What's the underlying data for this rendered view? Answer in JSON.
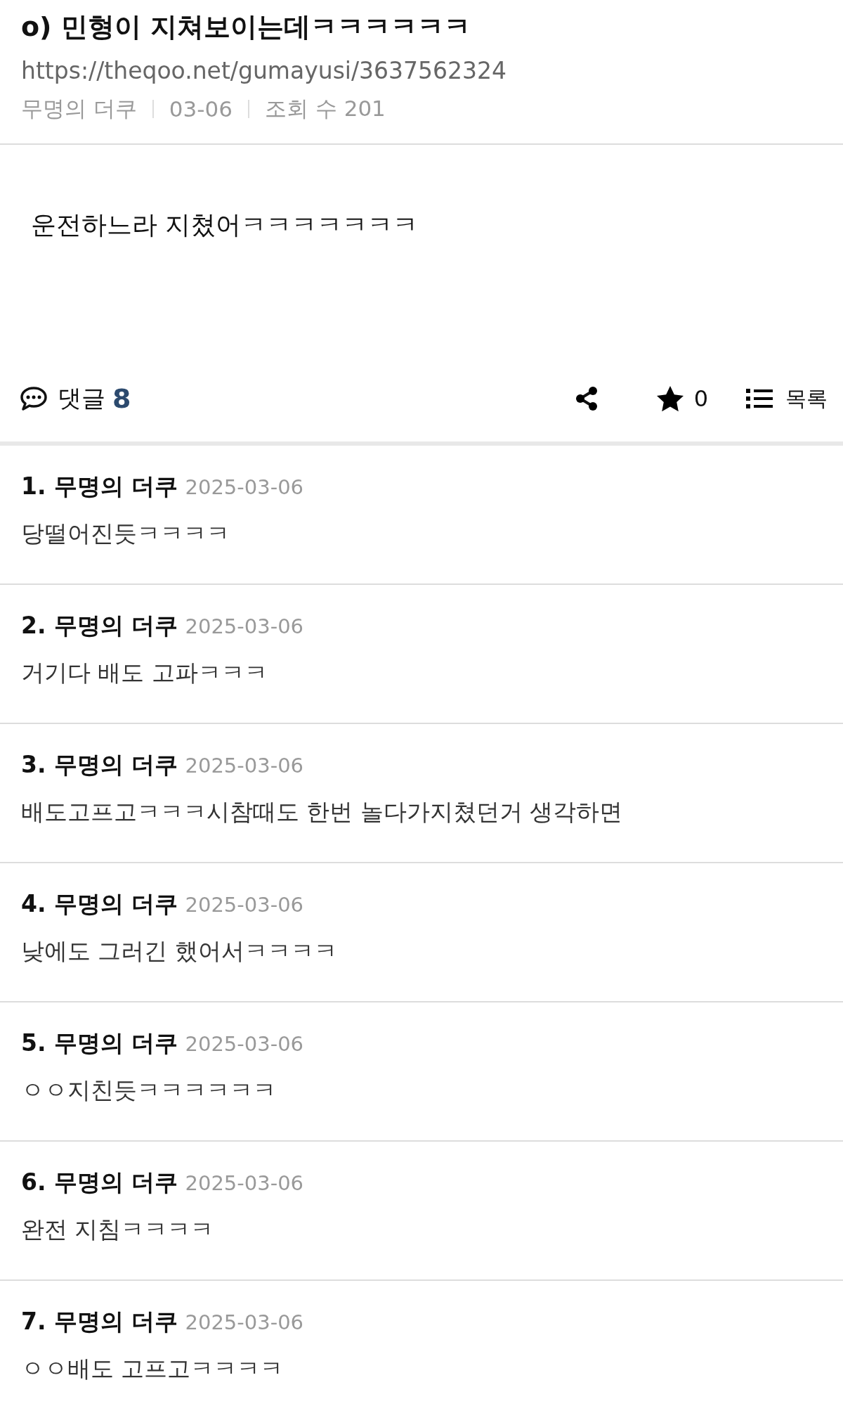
{
  "post": {
    "title": "o) 민형이 지쳐보이는데ㅋㅋㅋㅋㅋㅋ",
    "url": "https://theqoo.net/gumayusi/3637562324",
    "author": "무명의 더쿠",
    "date": "03-06",
    "views": "조회 수 201",
    "body": "운전하느라 지쳤어ㅋㅋㅋㅋㅋㅋㅋ"
  },
  "toolbar": {
    "comments_label": "댓글",
    "comments_count": "8",
    "stars": "0",
    "list_label": "목록"
  },
  "comments": [
    {
      "number": "1.",
      "author": "무명의 더쿠",
      "date": "2025-03-06",
      "text": "당떨어진듯ㅋㅋㅋㅋ"
    },
    {
      "number": "2.",
      "author": "무명의 더쿠",
      "date": "2025-03-06",
      "text": "거기다 배도 고파ㅋㅋㅋ"
    },
    {
      "number": "3.",
      "author": "무명의 더쿠",
      "date": "2025-03-06",
      "text": "배도고프고ㅋㅋㅋ시참때도 한번 놀다가지쳤던거 생각하면"
    },
    {
      "number": "4.",
      "author": "무명의 더쿠",
      "date": "2025-03-06",
      "text": "낮에도 그러긴 했어서ㅋㅋㅋㅋ"
    },
    {
      "number": "5.",
      "author": "무명의 더쿠",
      "date": "2025-03-06",
      "text": "ㅇㅇ지친듯ㅋㅋㅋㅋㅋㅋ"
    },
    {
      "number": "6.",
      "author": "무명의 더쿠",
      "date": "2025-03-06",
      "text": "완전 지침ㅋㅋㅋㅋ"
    },
    {
      "number": "7.",
      "author": "무명의 더쿠",
      "date": "2025-03-06",
      "text": "ㅇㅇ배도 고프고ㅋㅋㅋㅋ"
    }
  ]
}
